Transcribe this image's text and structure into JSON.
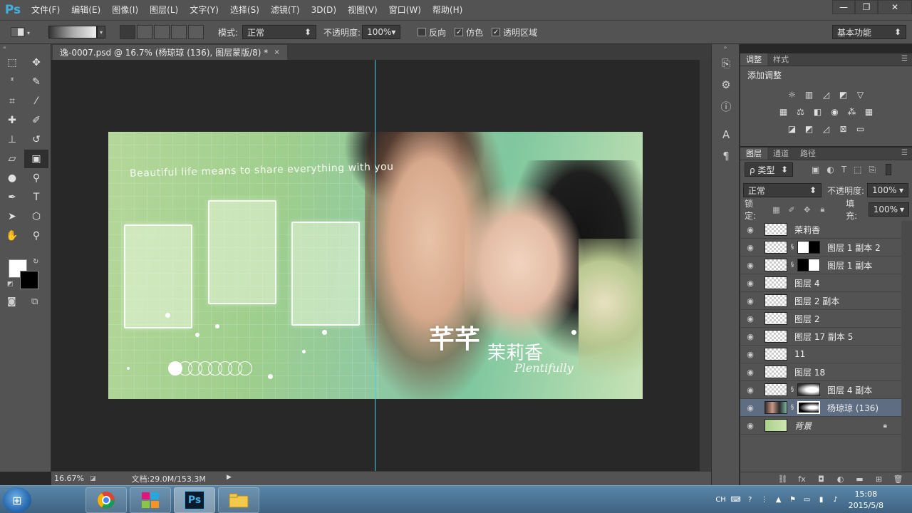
{
  "app": {
    "logo": "Ps"
  },
  "menu": [
    "文件(F)",
    "编辑(E)",
    "图像(I)",
    "图层(L)",
    "文字(Y)",
    "选择(S)",
    "滤镜(T)",
    "3D(D)",
    "视图(V)",
    "窗口(W)",
    "帮助(H)"
  ],
  "window_controls": {
    "minimize": "—",
    "restore": "❐",
    "close": "✕"
  },
  "options": {
    "mode_label": "模式:",
    "mode_value": "正常",
    "opacity_label": "不透明度:",
    "opacity_value": "100%",
    "reverse_label": "反向",
    "reverse_checked": "",
    "dither_label": "仿色",
    "dither_checked": "✓",
    "transparency_label": "透明区域",
    "transparency_checked": "✓",
    "workspace": "基本功能"
  },
  "document": {
    "tab_title": "逸-0007.psd @ 16.7% (杨琼琼 (136), 图层蒙版/8) *",
    "tab_close": "×",
    "zoom": "16.67%",
    "doc_size": "文档:29.0M/153.3M",
    "status_arrow": "▶"
  },
  "artwork": {
    "tagline": "Beautiful life means to share everything with you",
    "title": "芊芊",
    "title_sub": "茉莉香",
    "script": "Plentifully"
  },
  "panels": {
    "adjust_tab": "调整",
    "style_tab": "样式",
    "adjust_title": "添加调整",
    "layers_tab": "图层",
    "channels_tab": "通道",
    "paths_tab": "路径",
    "filter_type": "ρ 类型",
    "blend_mode": "正常",
    "opacity_label": "不透明度:",
    "opacity_value": "100%",
    "lock_label": "锁定:",
    "fill_label": "填充:",
    "fill_value": "100%"
  },
  "layers": [
    {
      "name": "茉莉香"
    },
    {
      "name": "图层 1 副本 2"
    },
    {
      "name": "图层 1 副本"
    },
    {
      "name": "图层 4"
    },
    {
      "name": "图层 2 副本"
    },
    {
      "name": "图层 2"
    },
    {
      "name": "图层 17 副本 5"
    },
    {
      "name": "11"
    },
    {
      "name": "图层 18"
    },
    {
      "name": "图层 4 副本"
    },
    {
      "name": "杨琼琼 (136)"
    },
    {
      "name": "背景"
    }
  ],
  "taskbar": {
    "ps_label": "Ps",
    "lang": "CH",
    "time": "15:08",
    "date": "2015/5/8"
  }
}
